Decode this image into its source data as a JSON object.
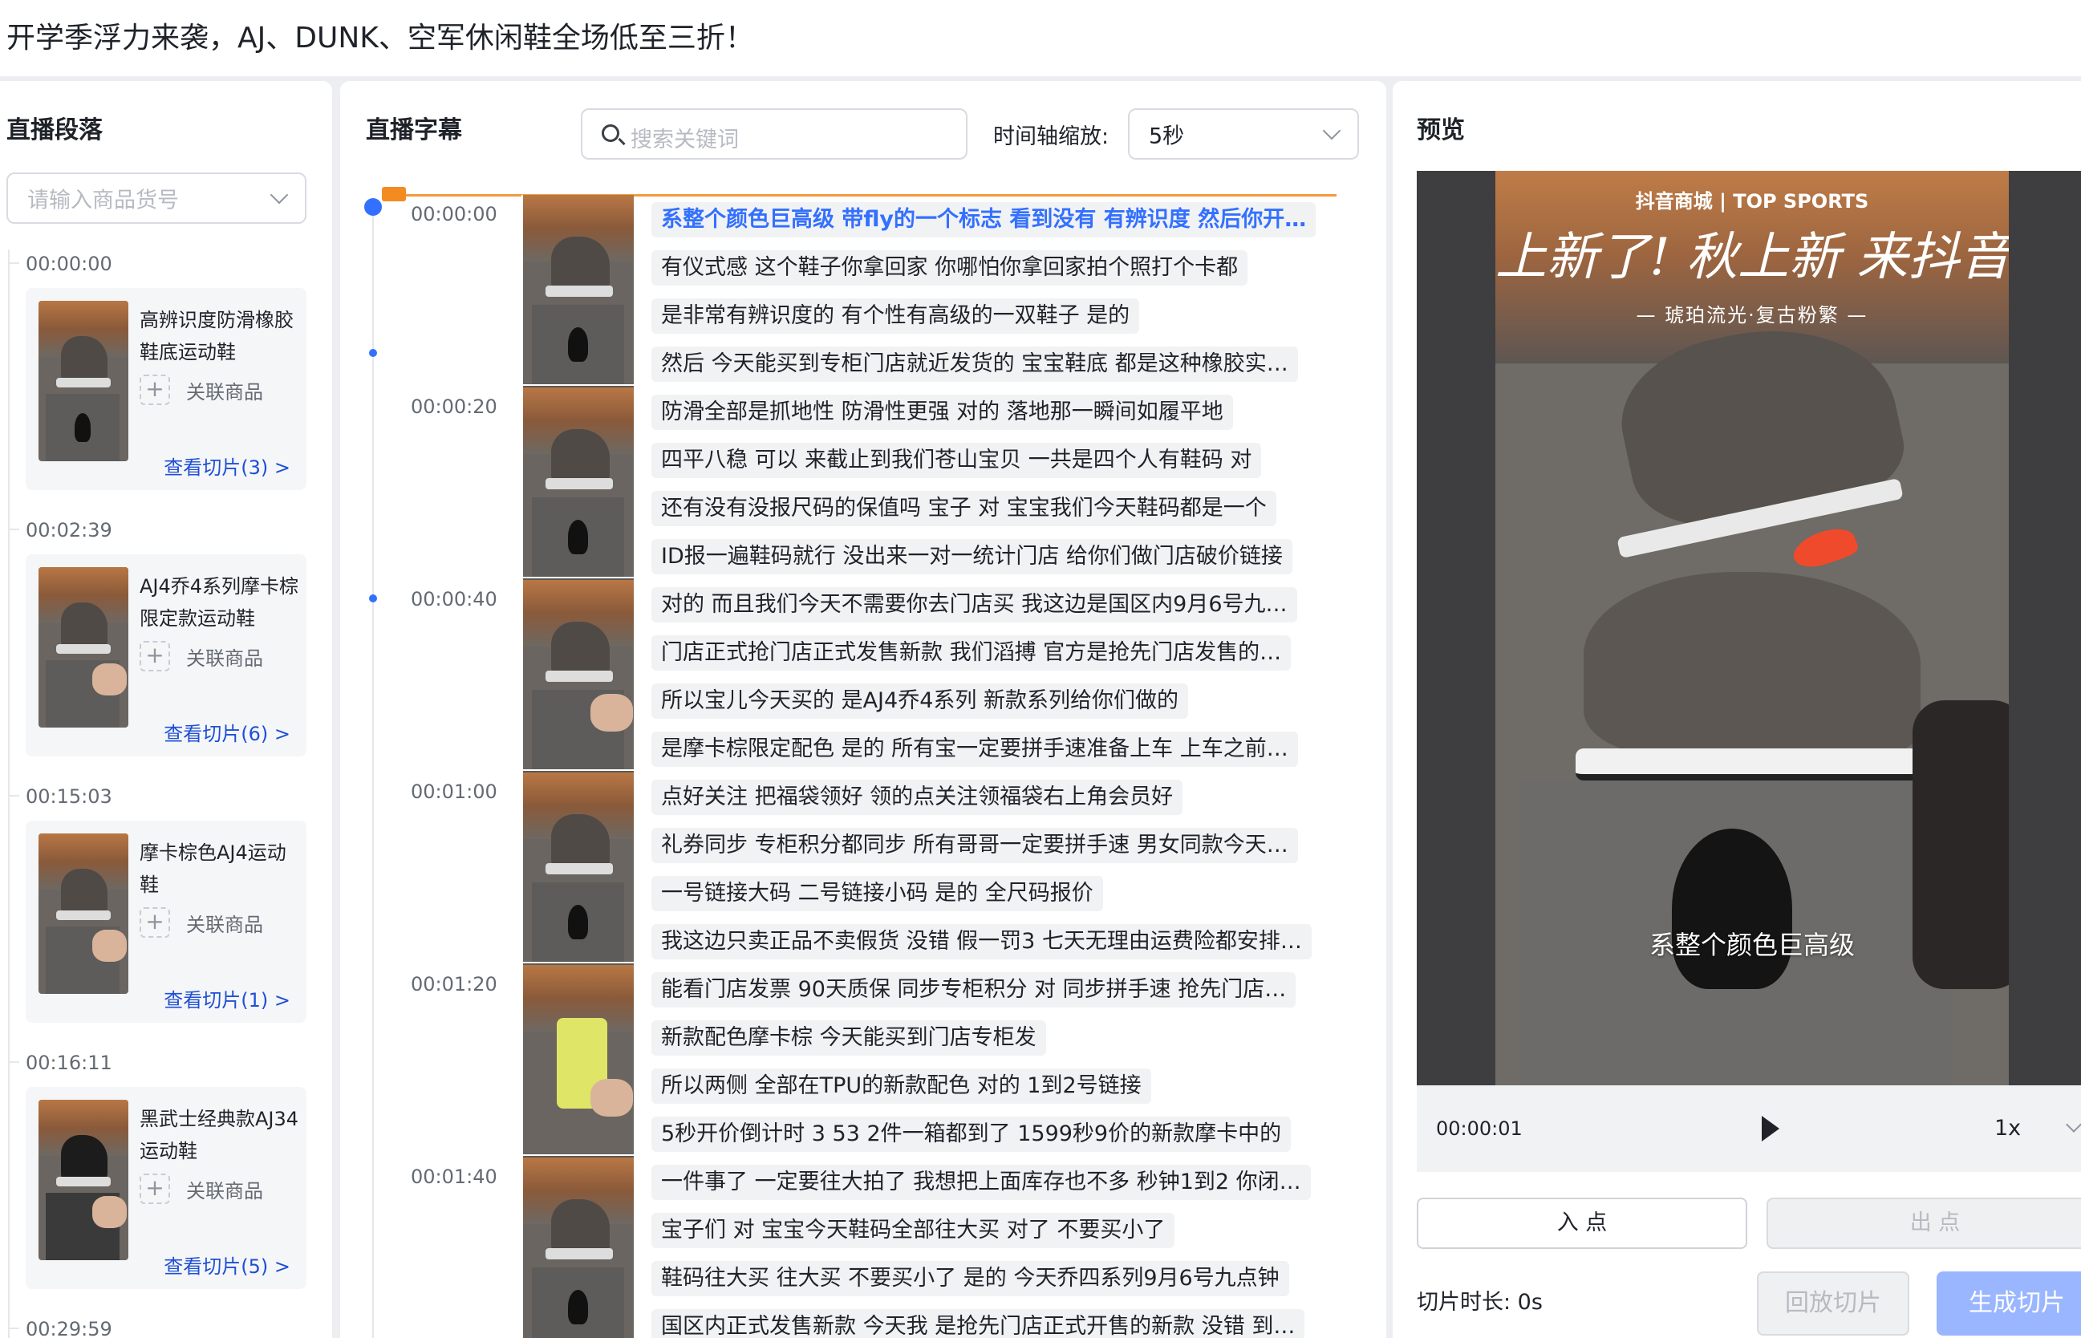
{
  "page": {
    "title": "开学季浮力来袭，AJ、DUNK、空军休闲鞋全场低至三折！"
  },
  "left": {
    "title": "直播段落",
    "select_placeholder": "请输入商品货号",
    "segments": [
      {
        "time": "00:00:00",
        "name": "高辨识度防滑橡胶鞋底运动鞋",
        "assoc": "关联商品",
        "view": "查看切片(3) >"
      },
      {
        "time": "00:02:39",
        "name": "AJ4乔4系列摩卡棕限定款运动鞋",
        "assoc": "关联商品",
        "view": "查看切片(6) >"
      },
      {
        "time": "00:15:03",
        "name": "摩卡棕色AJ4运动鞋",
        "assoc": "关联商品",
        "view": "查看切片(1) >"
      },
      {
        "time": "00:16:11",
        "name": "黑武士经典款AJ34运动鞋",
        "assoc": "关联商品",
        "view": "查看切片(5) >"
      },
      {
        "time": "00:29:59",
        "name": "",
        "assoc": "",
        "view": ""
      }
    ]
  },
  "middle": {
    "title": "直播字幕",
    "search_placeholder": "搜索关键词",
    "zoom_label": "时间轴缩放:",
    "zoom_value": "5秒",
    "time_marks": [
      "00:00:00",
      "00:00:20",
      "00:00:40",
      "00:01:00",
      "00:01:20",
      "00:01:40"
    ],
    "subtitles": [
      "系整个颜色巨高级 带fly的一个标志 看到没有 有辨识度 然后你开…",
      "有仪式感 这个鞋子你拿回家 你哪怕你拿回家拍个照打个卡都",
      "是非常有辨识度的 有个性有高级的一双鞋子 是的",
      "然后 今天能买到专柜门店就近发货的 宝宝鞋底 都是这种橡胶实…",
      "防滑全部是抓地性 防滑性更强 对的 落地那一瞬间如履平地",
      "四平八稳 可以 来截止到我们苍山宝贝 一共是四个人有鞋码 对",
      "还有没有没报尺码的保值吗 宝子 对 宝宝我们今天鞋码都是一个",
      "ID报一遍鞋码就行 没出来一对一统计门店 给你们做门店破价链接",
      "对的 而且我们今天不需要你去门店买 我这边是国区内9月6号九…",
      "门店正式抢门店正式发售新款 我们滔搏 官方是抢先门店发售的…",
      "所以宝儿今天买的 是AJ4乔4系列 新款系列给你们做的",
      "是摩卡棕限定配色 是的 所有宝一定要拼手速准备上车 上车之前…",
      "点好关注 把福袋领好 领的点关注领福袋右上角会员好",
      "礼券同步 专柜积分都同步 所有哥哥一定要拼手速 男女同款今天…",
      "一号链接大码 二号链接小码 是的 全尺码报价",
      "我这边只卖正品不卖假货 没错 假一罚3 七天无理由运费险都安排…",
      "能看门店发票 90天质保 同步专柜积分 对 同步拼手速 抢先门店…",
      "新款配色摩卡棕 今天能买到门店专柜发",
      "所以两侧 全部在TPU的新款配色 对的 1到2号链接",
      "5秒开价倒计时 3 53 2件一箱都到了 1599秒9价的新款摩卡中的",
      "一件事了 一定要往大拍了 我想把上面库存也不多 秒钟1到2 你闭…",
      "宝子们 对 宝宝今天鞋码全部往大买 对了 不要买小了",
      "鞋码往大买 往大买 不要买小了 是的 今天乔四系列9月6号九点钟",
      "国区内正式发售新款 今天我 是抢先门店正式开售的新款 没错 到…"
    ]
  },
  "right": {
    "title": "预览",
    "video": {
      "brand": "抖音商城 | TOP SPORTS",
      "headline": "上新了! 秋上新 来抖音",
      "tagline": "— 琥珀流光·复古粉繁 —",
      "caption": "系整个颜色巨高级",
      "current_time": "00:00:01",
      "speed": "1x"
    },
    "in_point": "入 点",
    "out_point": "出 点",
    "duration_label": "切片时长:  0s",
    "replay": "回放切片",
    "generate": "生成切片"
  }
}
